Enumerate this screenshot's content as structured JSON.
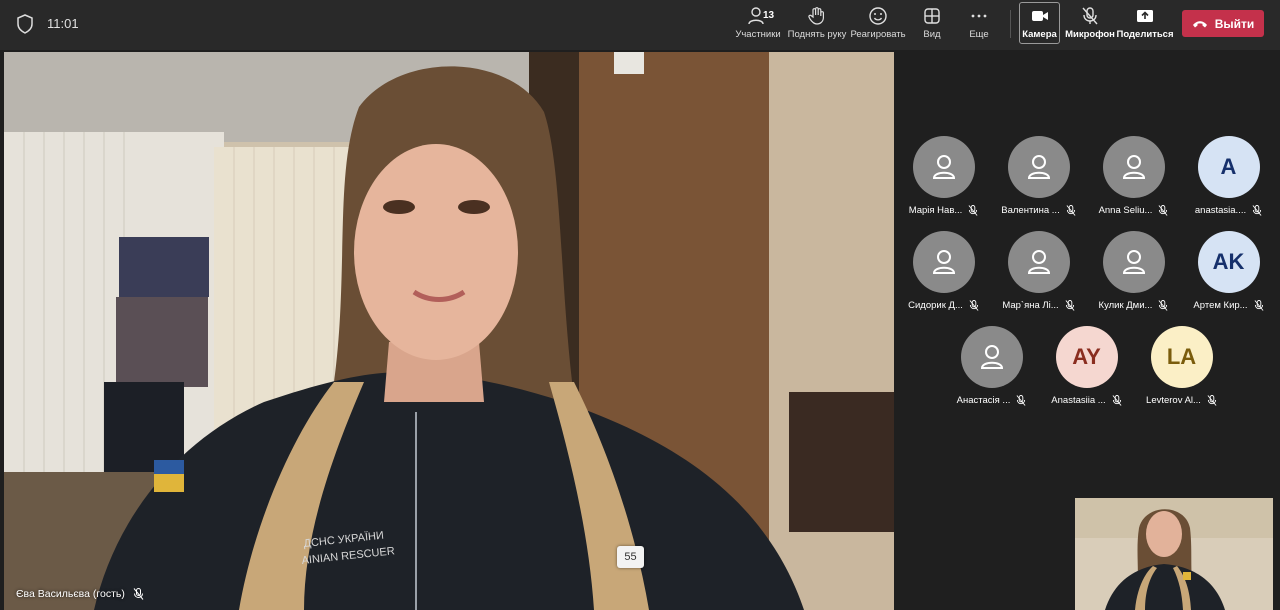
{
  "header": {
    "time": "11:01",
    "participants": {
      "count": "13",
      "label": "Участники"
    },
    "raise_hand": "Поднять руку",
    "react": "Реагировать",
    "view": "Вид",
    "more": "Еще",
    "camera": "Камера",
    "mic": "Микрофон",
    "share": "Поделиться",
    "leave": "Выйти"
  },
  "main": {
    "speaker_name": "Єва Васильєва (гость)",
    "badge": "55"
  },
  "participants": [
    {
      "name": "Марія Нав...",
      "initials": "",
      "bg": "#8a8a8a",
      "fg": "#ffffff"
    },
    {
      "name": "Валентина ...",
      "initials": "",
      "bg": "#8a8a8a",
      "fg": "#ffffff"
    },
    {
      "name": "Anna Seliu...",
      "initials": "",
      "bg": "#8a8a8a",
      "fg": "#ffffff"
    },
    {
      "name": "anastasia....",
      "initials": "A",
      "bg": "#d6e3f4",
      "fg": "#16306b"
    },
    {
      "name": "Сидорик Д...",
      "initials": "",
      "bg": "#8a8a8a",
      "fg": "#ffffff"
    },
    {
      "name": "Мар`яна Лі...",
      "initials": "",
      "bg": "#8a8a8a",
      "fg": "#ffffff"
    },
    {
      "name": "Кулик Дми...",
      "initials": "",
      "bg": "#8a8a8a",
      "fg": "#ffffff"
    },
    {
      "name": "Артем Кир...",
      "initials": "AK",
      "bg": "#d6e3f4",
      "fg": "#16306b"
    },
    {
      "name": "Анастасія ...",
      "initials": "",
      "bg": "#8a8a8a",
      "fg": "#ffffff"
    },
    {
      "name": "Anastasiia ...",
      "initials": "AY",
      "bg": "#f5d7d0",
      "fg": "#8a2d1f"
    },
    {
      "name": "Levterov Al...",
      "initials": "LA",
      "bg": "#fbefc6",
      "fg": "#7a5c0c"
    }
  ],
  "colors": {
    "accent_leave": "#c4314b",
    "topbar": "#292929",
    "background": "#1f1f1f"
  }
}
